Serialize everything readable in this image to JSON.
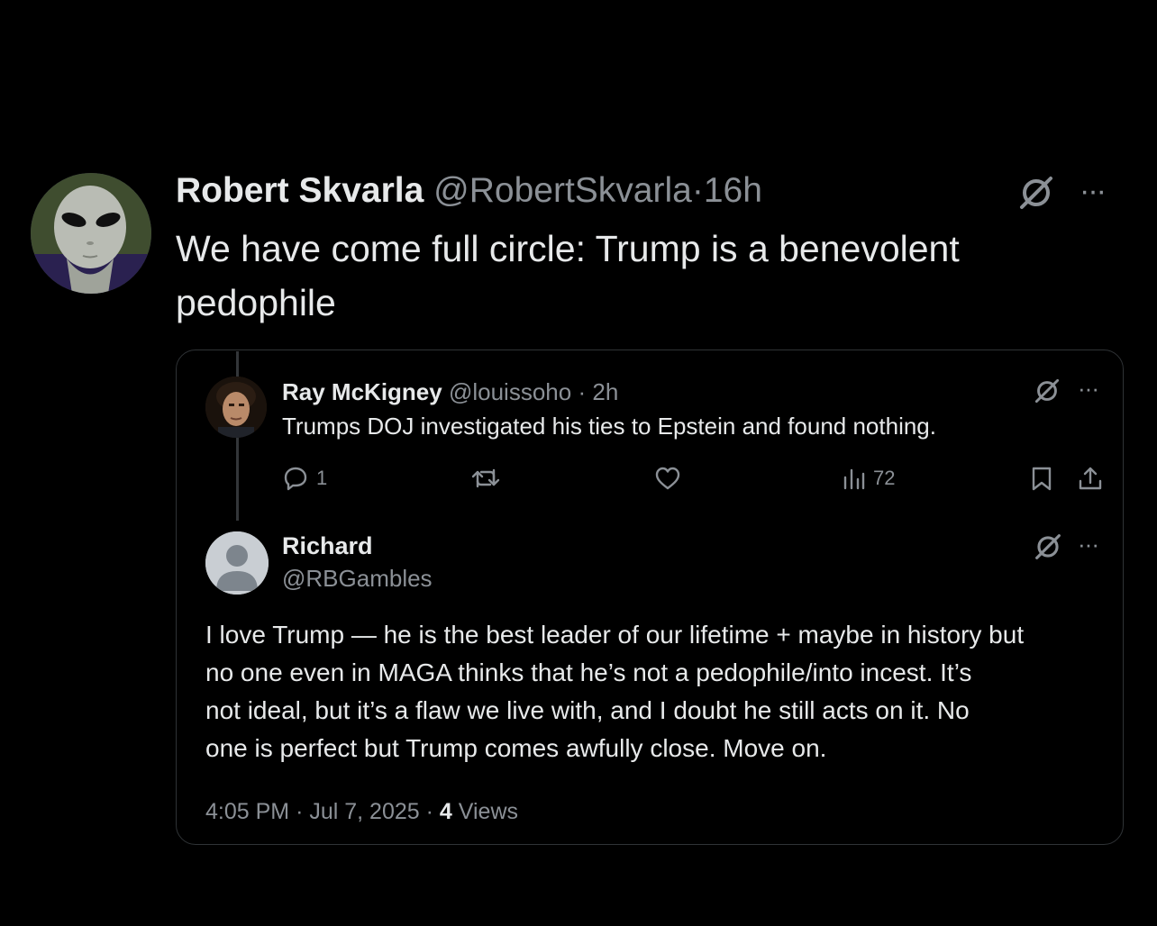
{
  "main_post": {
    "author_name": "Robert Skvarla",
    "author_handle": "@RobertSkvarla",
    "separator": "·",
    "time": "16h",
    "text": "We have come full circle: Trump is a benevolent pedophile"
  },
  "quoted_thread": {
    "first_reply": {
      "author_name": "Ray McKigney",
      "author_handle": "@louissoho",
      "separator": "·",
      "time": "2h",
      "text": "Trumps DOJ investigated his ties to Epstein and found nothing.",
      "actions": {
        "reply_count": "1",
        "views_count": "72"
      }
    },
    "second_reply": {
      "author_name": "Richard",
      "author_handle": "@RBGambles",
      "text_lines": [
        "I love Trump — he is the best leader of our lifetime + maybe in history but",
        "no one even in MAGA thinks that he’s not a pedophile/into incest.  It’s",
        "not ideal, but it’s a flaw we live with, and I doubt he still acts on it.  No",
        "one is perfect but Trump comes awfully close. Move on."
      ],
      "meta": {
        "time": "4:05 PM",
        "date": "Jul 7, 2025",
        "separator": "·",
        "views_count": "4",
        "views_label": "Views"
      }
    }
  },
  "icons": {
    "grok": "grok-icon",
    "more": "more-icon",
    "reply": "reply-icon",
    "repost": "repost-icon",
    "like": "like-icon",
    "views": "views-icon",
    "bookmark": "bookmark-icon",
    "share": "share-icon"
  },
  "more_glyph": "···",
  "colors": {
    "background": "#000000",
    "text_primary": "#e7e9ea",
    "text_secondary": "#8b9096",
    "border": "#2f3336"
  }
}
